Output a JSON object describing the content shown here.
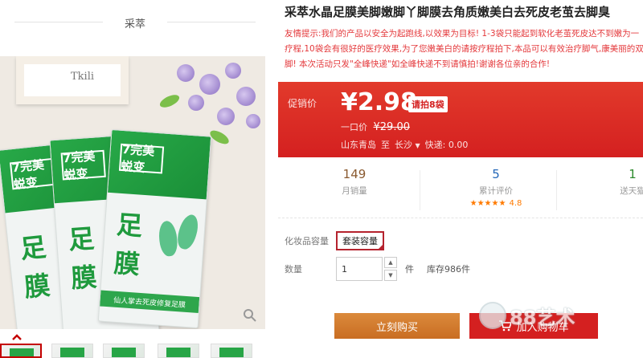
{
  "shop": {
    "title": "采萃"
  },
  "product_image": {
    "frame_text": "Tkili",
    "pack_brand": "7完美蜕变",
    "pack_name_1": "足",
    "pack_name_2": "膜",
    "pack_band": "仙人掌去死皮修复足膜"
  },
  "product": {
    "title": "采萃水晶足膜美脚嫩脚丫脚膜去角质嫩美白去死皮老茧去脚臭",
    "description": "友情提示:我们的产品以安全为起跑线,以效果为目标! 1-3袋只能起到软化老茧死皮达不到嫩为一疗程,10袋会有很好的医疗效果,为了您嫩美白的请按疗程拍下,本品可以有效治疗脚气,康美丽的双脚! 本次活动只发\"全峰快递\"如全峰快递不到请慎拍!谢谢各位亲的合作!"
  },
  "price": {
    "label": "促销价",
    "current": "¥2.98",
    "tag": "请拍8袋",
    "original_label": "一口价",
    "original": "¥29.00",
    "ship_from": "山东青岛",
    "ship_to_label": "至",
    "ship_to": "长沙",
    "delivery": "快递: 0.00"
  },
  "stats": [
    {
      "value": "149",
      "label": "月销量"
    },
    {
      "value": "5",
      "label": "累计评价",
      "stars": "★★★★★",
      "rating": "4.8"
    },
    {
      "value": "1",
      "label": "送天猫"
    }
  ],
  "spec": {
    "label": "化妆品容量",
    "option": "套装容量"
  },
  "quantity": {
    "label": "数量",
    "value": "1",
    "unit": "件",
    "stock": "库存986件"
  },
  "buttons": {
    "buy": "立刻购买",
    "cart": "加入购物车"
  },
  "watermark": {
    "text": "88艺术"
  }
}
